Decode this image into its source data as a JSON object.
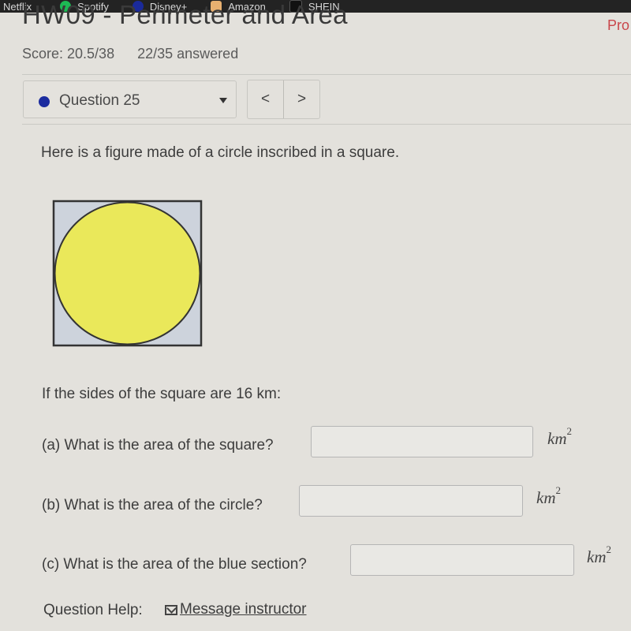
{
  "bookmarks": [
    {
      "label": "Netflix",
      "icon": "netflix-icon",
      "color": "#d81f26"
    },
    {
      "label": "Spotify",
      "icon": "spotify-icon",
      "color": "#1db954"
    },
    {
      "label": "Disney+",
      "icon": "disney-icon",
      "color": "#1a2a9a"
    },
    {
      "label": "Amazon",
      "icon": "amazon-icon",
      "color": "#e8b070"
    },
    {
      "label": "SHEIN",
      "icon": "shein-icon",
      "color": "#111111"
    }
  ],
  "header": {
    "title": "HW09 - Perimeter and Area",
    "right_link": "Pro",
    "score": "Score: 20.5/38",
    "answered": "22/35 answered"
  },
  "question_nav": {
    "selected": "Question 25",
    "status_color": "#1c2c9f",
    "prev_label": "<",
    "next_label": ">"
  },
  "question": {
    "intro": "Here is a figure made of a circle inscribed in a square.",
    "figure": {
      "square_color": "#cdd3dc",
      "circle_color": "#eae85a",
      "outline_color": "#333333"
    },
    "prompt": "If the sides of the square are 16 km:",
    "parts": [
      {
        "label": "(a) What is the area of the square?",
        "value": "",
        "unit": "km",
        "exponent": "2"
      },
      {
        "label": "(b) What is the area of the circle?",
        "value": "",
        "unit": "km",
        "exponent": "2"
      },
      {
        "label": "(c) What is the area of the blue section?",
        "value": "",
        "unit": "km",
        "exponent": "2"
      }
    ]
  },
  "help": {
    "label": "Question Help:",
    "message_link": "Message instructor"
  }
}
